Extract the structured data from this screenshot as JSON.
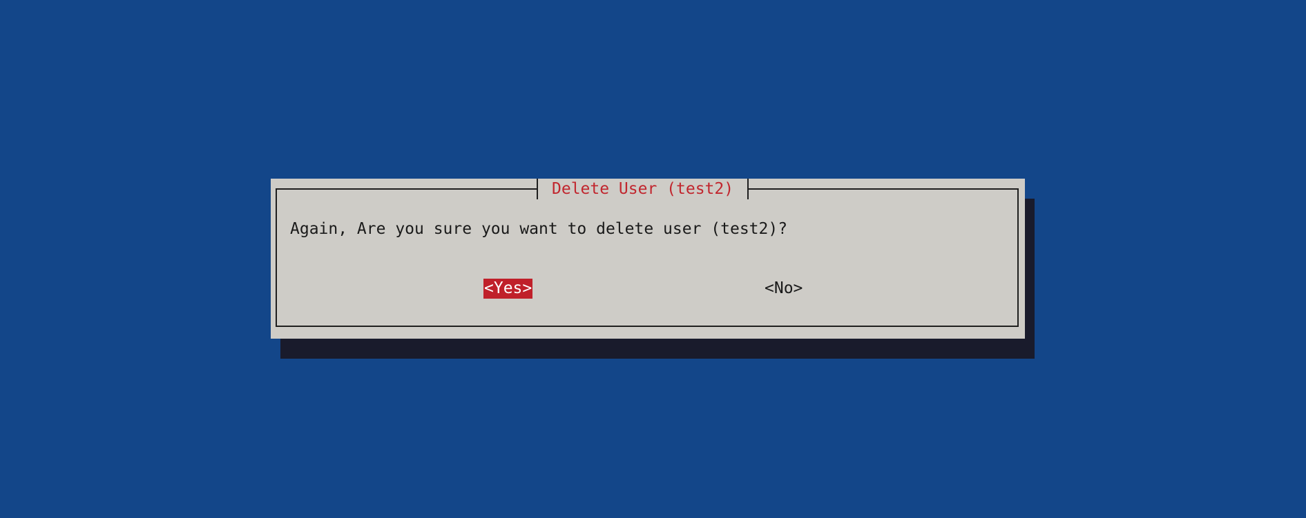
{
  "dialog": {
    "title": "Delete User (test2)",
    "message": "Again, Are you sure you want to delete user (test2)?",
    "buttons": {
      "yes_label": "<Yes>",
      "no_label": "<No>",
      "selected": "yes"
    }
  },
  "colors": {
    "background": "#134689",
    "dialog_background": "#ceccc7",
    "shadow": "#191b2c",
    "title_text": "#c1262e",
    "selected_button_background": "#c0202a",
    "selected_button_text": "#ffffff",
    "text": "#1a1a1a"
  }
}
